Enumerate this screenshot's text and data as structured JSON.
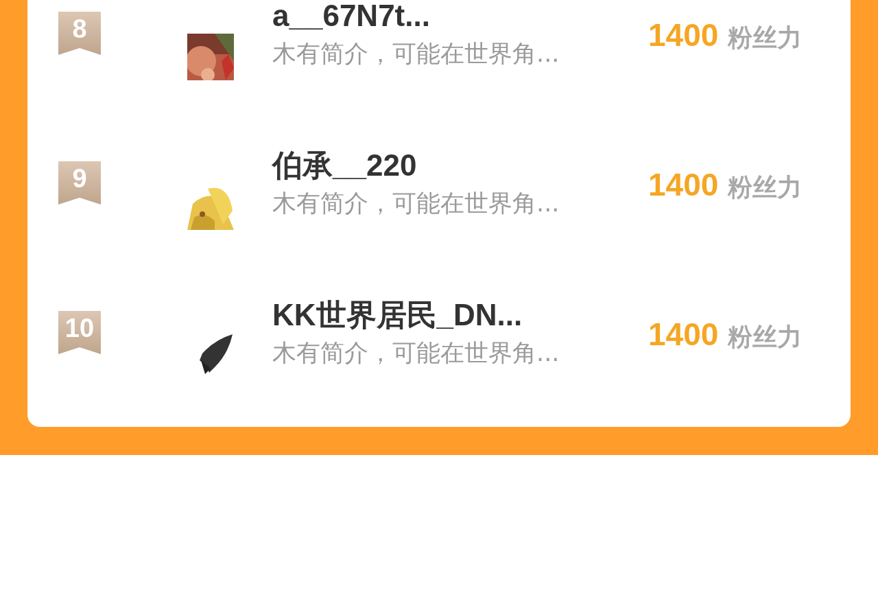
{
  "rankings": [
    {
      "rank": "8",
      "name": "a__67N7t...",
      "bio": "木有简介，可能在世界角...",
      "fans": "1400",
      "fans_label": "粉丝力"
    },
    {
      "rank": "9",
      "name": "伯承__220",
      "bio": "木有简介，可能在世界角...",
      "fans": "1400",
      "fans_label": "粉丝力"
    },
    {
      "rank": "10",
      "name": "KK世界居民_DN...",
      "bio": "木有简介，可能在世界角...",
      "fans": "1400",
      "fans_label": "粉丝力"
    }
  ]
}
